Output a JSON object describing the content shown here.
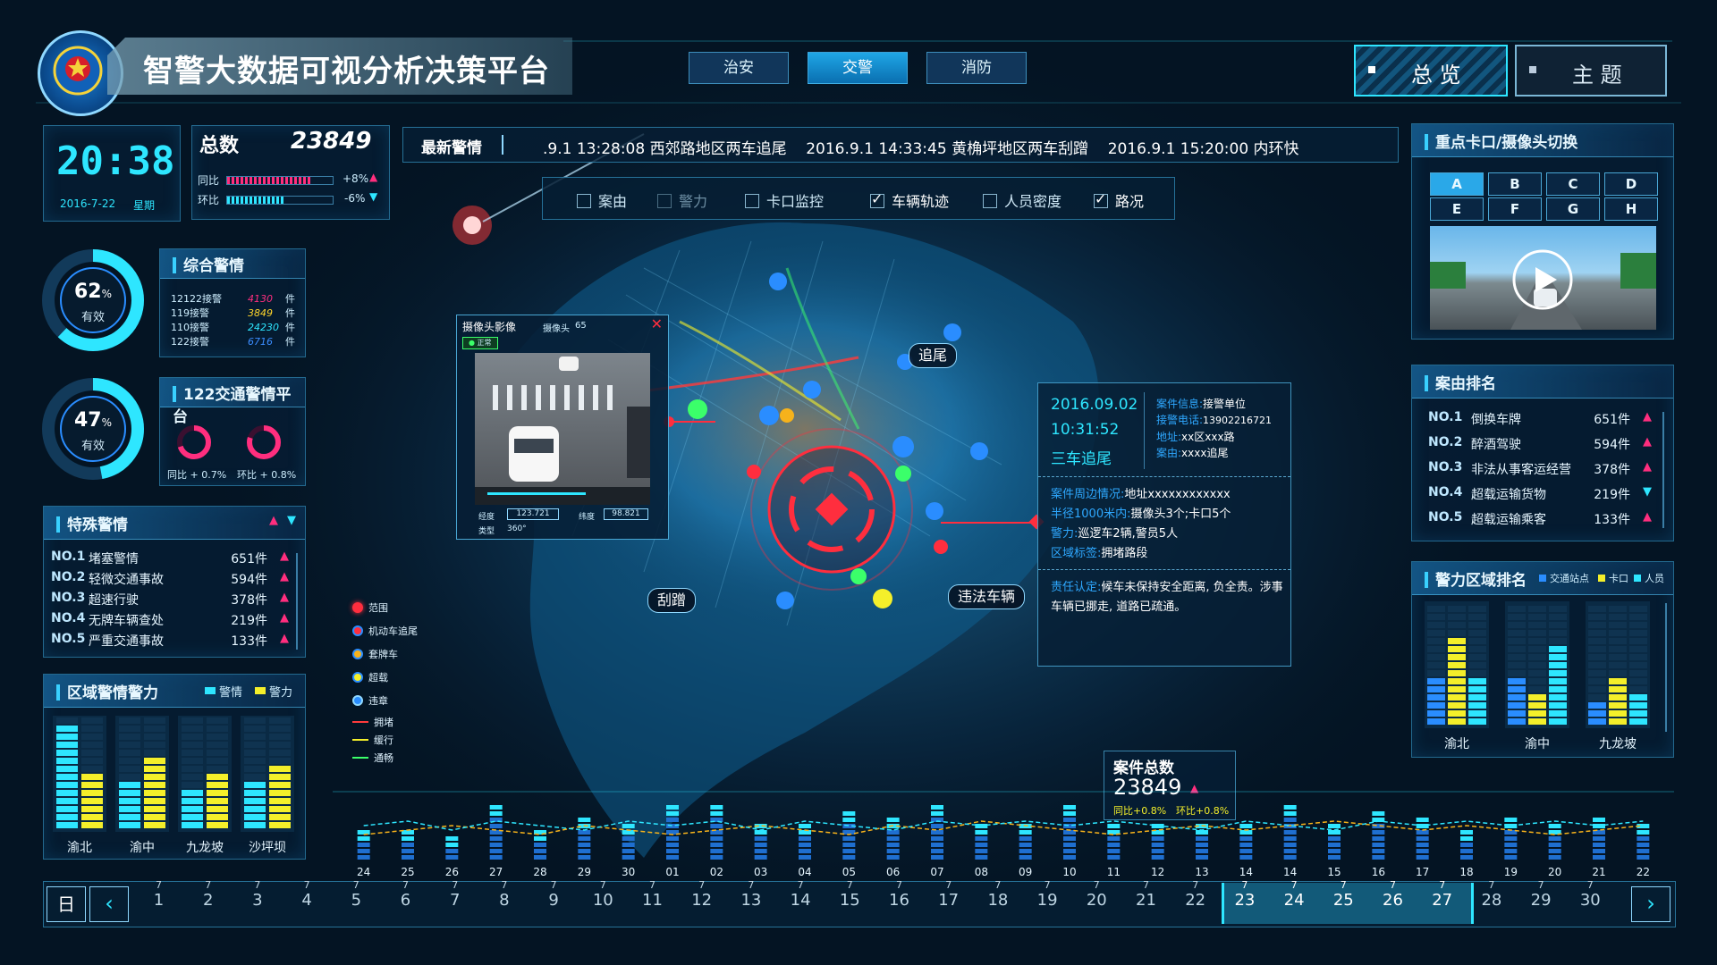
{
  "header": {
    "title": "智警大数据可视分析决策平台",
    "tabs": [
      {
        "label": "治安",
        "active": false
      },
      {
        "label": "交警",
        "active": true
      },
      {
        "label": "消防",
        "active": false
      }
    ],
    "view_buttons": [
      {
        "label": "总 览",
        "active": true
      },
      {
        "label": "主 题",
        "active": false
      }
    ]
  },
  "clock": {
    "time": "20:38",
    "date": "2016-7-22",
    "weekday": "星期"
  },
  "total": {
    "label": "总数",
    "value": "23849",
    "yoy_label": "同比",
    "yoy_value": "+8%",
    "yoy_fraction": 0.8,
    "mom_label": "环比",
    "mom_value": "-6%",
    "mom_fraction": 0.55
  },
  "comprehensive": {
    "title": "综合警情",
    "gauge_value": "62",
    "gauge_unit": "%",
    "gauge_label": "有效",
    "gauge_fraction": 0.62,
    "rows": [
      {
        "label": "12122接警",
        "value": "4130",
        "unit": "件",
        "color": "#ff2e7e"
      },
      {
        "label": "119接警",
        "value": "3849",
        "unit": "件",
        "color": "#ffd52a"
      },
      {
        "label": "110接警",
        "value": "24230",
        "unit": "件",
        "color": "#2ee6ff"
      },
      {
        "label": "122接警",
        "value": "6716",
        "unit": "件",
        "color": "#3b8dff"
      }
    ]
  },
  "traffic122": {
    "title": "122交通警情平台",
    "gauge_value": "47",
    "gauge_unit": "%",
    "gauge_label": "有效",
    "gauge_fraction": 0.47,
    "yoy_text": "同比 + 0.7%",
    "mom_text": "环比 + 0.8%",
    "yoy_fraction": 0.7,
    "mom_fraction": 0.8
  },
  "special": {
    "title": "特殊警情",
    "rows": [
      {
        "no": "NO.1",
        "name": "堵塞警情",
        "count": "651件"
      },
      {
        "no": "NO.2",
        "name": "轻微交通事故",
        "count": "594件"
      },
      {
        "no": "NO.3",
        "name": "超速行驶",
        "count": "378件"
      },
      {
        "no": "NO.4",
        "name": "无牌车辆查处",
        "count": "219件"
      },
      {
        "no": "NO.5",
        "name": "严重交通事故",
        "count": "133件"
      }
    ]
  },
  "region_left": {
    "title": "区域警情警力",
    "legend": [
      {
        "label": "警情",
        "color": "#2ee6ff"
      },
      {
        "label": "警力",
        "color": "#f4ef2a"
      }
    ],
    "chart_data": {
      "type": "bar",
      "categories": [
        "渝北",
        "渝中",
        "九龙坡",
        "沙坪坝"
      ],
      "series": [
        {
          "name": "警情",
          "values": [
            13,
            6,
            5,
            6
          ]
        },
        {
          "name": "警力",
          "values": [
            7,
            9,
            7,
            8
          ]
        }
      ],
      "ylim": [
        0,
        14
      ]
    }
  },
  "ticker": {
    "label": "最新警情",
    "text": ".9.1 13:28:08 西郊路地区两车追尾    2016.9.1 14:33:45 黄桷坪地区两车刮蹭    2016.9.1 15:20:00 内环快"
  },
  "layers": [
    {
      "label": "案由",
      "checked": false
    },
    {
      "label": "警力",
      "checked": false
    },
    {
      "label": "卡口监控",
      "checked": false
    },
    {
      "label": "车辆轨迹",
      "checked": true
    },
    {
      "label": "人员密度",
      "checked": false
    },
    {
      "label": "路况",
      "checked": true
    }
  ],
  "camera_popup": {
    "title": "摄像头影像",
    "camera_label": "摄像头",
    "camera_no": "65",
    "status": "正常",
    "lng_label": "经度",
    "lng_value": "123.721",
    "lat_label": "纬度",
    "lat_value": "98.821",
    "type_label": "类型",
    "type_value": "360°"
  },
  "map_labels": {
    "a": "追尾",
    "b": "刮蹭",
    "c": "违法车辆"
  },
  "incident": {
    "date": "2016.09.02",
    "time": "10:31:52",
    "type": "三车追尾",
    "unit_label": "案件信息:",
    "unit_value": "接警单位",
    "phone_label": "接警电话:",
    "phone_value": "13902216721",
    "addr_label": "地址:",
    "addr_value": "xx区xxx路",
    "cause_label": "案由:",
    "cause_value": "xxxx追尾",
    "around_label": "案件周边情况:",
    "around_value": "地址xxxxxxxxxxxx",
    "radius_label": "半径1000米内:",
    "radius_value": "摄像头3个;卡口5个",
    "force_label": "警力:",
    "force_value": "巡逻车2辆,警员5人",
    "area_label": "区域标签:",
    "area_value": "拥堵路段",
    "resp_label": "责任认定:",
    "resp_value": "候车未保持安全距离, 负全责。涉事车辆已挪走, 道路已疏通。"
  },
  "map_legend": [
    {
      "label": "范围",
      "kind": "dot",
      "color": "#ff2e3e"
    },
    {
      "label": "机动车追尾",
      "kind": "dot",
      "color": "#ff2e3e"
    },
    {
      "label": "套牌车",
      "kind": "dot",
      "color": "#f6b21b"
    },
    {
      "label": "超载",
      "kind": "dot",
      "color": "#f4ef2a"
    },
    {
      "label": "违章",
      "kind": "dot",
      "color": "#2a8dff"
    },
    {
      "label": "拥堵",
      "kind": "line",
      "color": "#ff3b3b"
    },
    {
      "label": "缓行",
      "kind": "line",
      "color": "#f4ef2a"
    },
    {
      "label": "通畅",
      "kind": "line",
      "color": "#3bff6a"
    }
  ],
  "cameras": {
    "title": "重点卡口/摄像头切换",
    "buttons": [
      "A",
      "B",
      "C",
      "D",
      "E",
      "F",
      "G",
      "H"
    ],
    "active": "A"
  },
  "case_rank": {
    "title": "案由排名",
    "rows": [
      {
        "no": "NO.1",
        "name": "倒换车牌",
        "count": "651件",
        "dir": "up"
      },
      {
        "no": "NO.2",
        "name": "醉酒驾驶",
        "count": "594件",
        "dir": "up"
      },
      {
        "no": "NO.3",
        "name": "非法从事客运经营",
        "count": "378件",
        "dir": "up"
      },
      {
        "no": "NO.4",
        "name": "超载运输货物",
        "count": "219件",
        "dir": "down"
      },
      {
        "no": "NO.5",
        "name": "超载运输乘客",
        "count": "133件",
        "dir": "up"
      }
    ]
  },
  "police_rank": {
    "title": "警力区域排名",
    "legend": [
      {
        "label": "交通站点",
        "color": "#2a8dff"
      },
      {
        "label": "卡口",
        "color": "#f4ef2a"
      },
      {
        "label": "人员",
        "color": "#2ee6ff"
      }
    ],
    "chart_data": {
      "type": "bar",
      "categories": [
        "渝北",
        "渝中",
        "九龙坡"
      ],
      "series": [
        {
          "name": "交通站点",
          "values": [
            6,
            6,
            3
          ]
        },
        {
          "name": "卡口",
          "values": [
            10,
            4,
            6
          ]
        },
        {
          "name": "人员",
          "values": [
            6,
            9,
            4
          ]
        }
      ],
      "ylim": [
        0,
        14
      ]
    }
  },
  "cases_total": {
    "label": "案件总数",
    "value": "23849",
    "yoy": "同比+0.8%",
    "mom": "环比+0.8%"
  },
  "bottom_chart": {
    "chart_data": {
      "type": "bar",
      "categories": [
        "24",
        "25",
        "26",
        "27",
        "28",
        "29",
        "30",
        "01",
        "02",
        "03",
        "04",
        "05",
        "06",
        "07",
        "08",
        "09",
        "10",
        "11",
        "12",
        "13",
        "14",
        "14",
        "15",
        "16",
        "17",
        "18",
        "19",
        "20",
        "21",
        "22"
      ],
      "values": [
        7,
        7,
        6,
        12,
        7,
        10,
        9,
        12,
        12,
        8,
        8,
        11,
        10,
        13,
        8,
        9,
        12,
        9,
        9,
        8,
        9,
        12,
        8,
        11,
        10,
        7,
        10,
        9,
        10,
        8
      ],
      "line1": [
        6,
        7,
        8,
        7,
        6,
        8,
        7,
        6,
        7,
        8,
        7,
        6,
        8,
        7,
        9,
        8,
        7,
        6,
        7,
        8,
        7,
        8,
        9,
        8,
        7,
        8,
        7,
        6,
        7,
        8
      ],
      "line2": [
        8,
        9,
        7,
        9,
        8,
        7,
        9,
        8,
        9,
        7,
        9,
        8,
        7,
        9,
        8,
        9,
        8,
        9,
        8,
        7,
        9,
        8,
        7,
        9,
        8,
        9,
        8,
        9,
        8,
        9
      ],
      "ylim": [
        0,
        14
      ]
    }
  },
  "timeline": {
    "unit": "日",
    "month": "7",
    "days": [
      "1",
      "2",
      "3",
      "4",
      "5",
      "6",
      "7",
      "8",
      "9",
      "10",
      "11",
      "12",
      "13",
      "14",
      "15",
      "16",
      "17",
      "18",
      "19",
      "20",
      "21",
      "22",
      "23",
      "24",
      "25",
      "26",
      "27",
      "28",
      "29",
      "30"
    ],
    "selected_from": "23",
    "selected_to": "27"
  },
  "colors": {
    "accent": "#2ee6ff",
    "warn": "#ff2e7e",
    "yellow": "#f4ef2a",
    "blue": "#2a8dff"
  }
}
